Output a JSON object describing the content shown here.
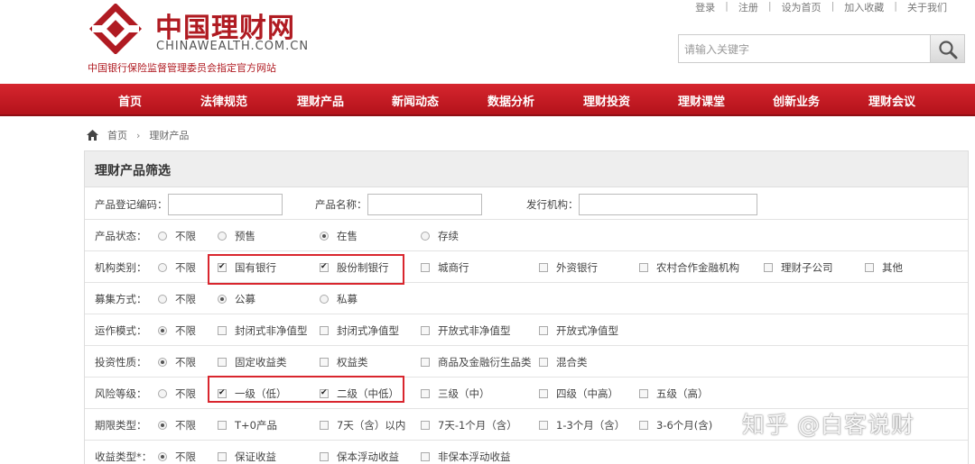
{
  "header": {
    "logo_cn": "中国理财网",
    "logo_en": "CHINAWEALTH.COM.CN",
    "tagline": "中国银行保险监督管理委员会指定官方网站",
    "top_links": [
      "登录",
      "注册",
      "设为首页",
      "加入收藏",
      "关于我们"
    ],
    "search_placeholder": "请输入关键字",
    "brand_color": "#b01b22"
  },
  "nav": {
    "items": [
      "首页",
      "法律规范",
      "理财产品",
      "新闻动态",
      "数据分析",
      "理财投资",
      "理财课堂",
      "创新业务",
      "理财会议"
    ]
  },
  "breadcrumb": {
    "items": [
      "首页",
      "理财产品"
    ]
  },
  "filter": {
    "title": "理财产品筛选",
    "text_fields": [
      {
        "label": "产品登记编码：",
        "value": ""
      },
      {
        "label": "产品名称：",
        "value": ""
      },
      {
        "label": "发行机构：",
        "value": ""
      }
    ],
    "rows": [
      {
        "label": "产品状态：",
        "options": [
          {
            "type": "radio",
            "text": "不限",
            "checked": false
          },
          {
            "type": "radio",
            "text": "预售",
            "checked": false
          },
          {
            "type": "radio",
            "text": "在售",
            "checked": true
          },
          {
            "type": "radio",
            "text": "存续",
            "checked": false
          }
        ]
      },
      {
        "label": "机构类别：",
        "options": [
          {
            "type": "radio",
            "text": "不限",
            "checked": false
          },
          {
            "type": "check",
            "text": "国有银行",
            "checked": true
          },
          {
            "type": "check",
            "text": "股份制银行",
            "checked": true
          },
          {
            "type": "check",
            "text": "城商行",
            "checked": false
          },
          {
            "type": "check",
            "text": "外资银行",
            "checked": false
          },
          {
            "type": "check",
            "text": "农村合作金融机构",
            "checked": false
          },
          {
            "type": "check",
            "text": "理财子公司",
            "checked": false
          },
          {
            "type": "check",
            "text": "其他",
            "checked": false
          }
        ]
      },
      {
        "label": "募集方式：",
        "options": [
          {
            "type": "radio",
            "text": "不限",
            "checked": false
          },
          {
            "type": "radio",
            "text": "公募",
            "checked": true
          },
          {
            "type": "radio",
            "text": "私募",
            "checked": false
          }
        ]
      },
      {
        "label": "运作模式：",
        "options": [
          {
            "type": "radio",
            "text": "不限",
            "checked": true
          },
          {
            "type": "check",
            "text": "封闭式非净值型",
            "checked": false
          },
          {
            "type": "check",
            "text": "封闭式净值型",
            "checked": false
          },
          {
            "type": "check",
            "text": "开放式非净值型",
            "checked": false
          },
          {
            "type": "check",
            "text": "开放式净值型",
            "checked": false
          }
        ]
      },
      {
        "label": "投资性质：",
        "options": [
          {
            "type": "radio",
            "text": "不限",
            "checked": true
          },
          {
            "type": "check",
            "text": "固定收益类",
            "checked": false
          },
          {
            "type": "check",
            "text": "权益类",
            "checked": false
          },
          {
            "type": "check",
            "text": "商品及金融衍生品类",
            "checked": false
          },
          {
            "type": "check",
            "text": "混合类",
            "checked": false
          }
        ]
      },
      {
        "label": "风险等级：",
        "options": [
          {
            "type": "radio",
            "text": "不限",
            "checked": false
          },
          {
            "type": "check",
            "text": "一级（低）",
            "checked": true
          },
          {
            "type": "check",
            "text": "二级（中低）",
            "checked": true
          },
          {
            "type": "check",
            "text": "三级（中）",
            "checked": false
          },
          {
            "type": "check",
            "text": "四级（中高）",
            "checked": false
          },
          {
            "type": "check",
            "text": "五级（高）",
            "checked": false
          }
        ]
      },
      {
        "label": "期限类型：",
        "options": [
          {
            "type": "radio",
            "text": "不限",
            "checked": true
          },
          {
            "type": "check",
            "text": "T+0产品",
            "checked": false
          },
          {
            "type": "check",
            "text": "7天（含）以内",
            "checked": false
          },
          {
            "type": "check",
            "text": "7天-1个月（含）",
            "checked": false
          },
          {
            "type": "check",
            "text": "1-3个月（含）",
            "checked": false
          },
          {
            "type": "check",
            "text": "3-6个月(含)",
            "checked": false
          }
        ]
      },
      {
        "label": "收益类型*：",
        "options": [
          {
            "type": "radio",
            "text": "不限",
            "checked": true
          },
          {
            "type": "check",
            "text": "保证收益",
            "checked": false
          },
          {
            "type": "check",
            "text": "保本浮动收益",
            "checked": false
          },
          {
            "type": "check",
            "text": "非保本浮动收益",
            "checked": false
          }
        ]
      }
    ]
  },
  "watermark": "知乎 @白客说财"
}
